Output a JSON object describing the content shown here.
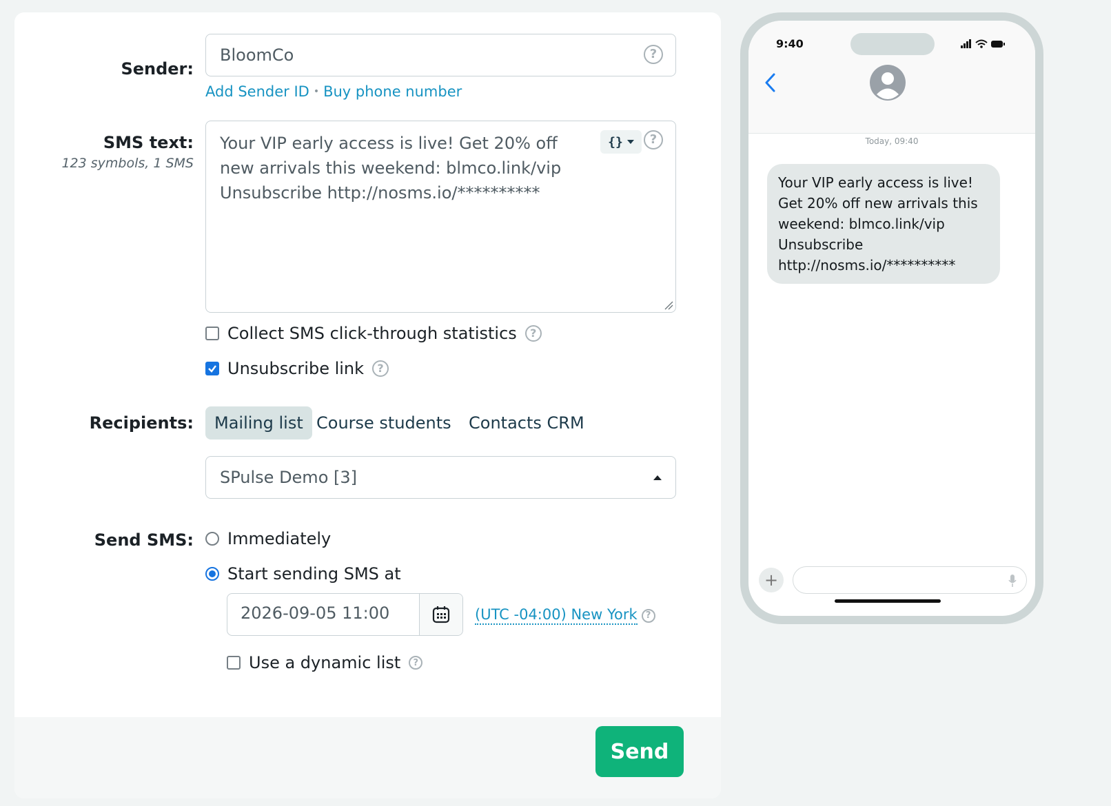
{
  "sender": {
    "label": "Sender:",
    "value": "BloomCo",
    "add_sender_id": "Add Sender ID",
    "separator": "•",
    "buy_phone_number": "Buy phone number"
  },
  "sms_text": {
    "label": "SMS text:",
    "stats": "123 symbols, 1 SMS",
    "value": "Your VIP early access is live! Get 20% off new arrivals this weekend: blmco.link/vip\nUnsubscribe http://nosms.io/**********",
    "variables_button": "{}"
  },
  "options": {
    "collect_stats_label": "Collect SMS click-through statistics",
    "collect_stats_checked": false,
    "unsubscribe_label": "Unsubscribe link",
    "unsubscribe_checked": true
  },
  "recipients": {
    "label": "Recipients:",
    "tabs": [
      {
        "label": "Mailing list",
        "active": true
      },
      {
        "label": "Course students",
        "active": false
      },
      {
        "label": "Contacts CRM",
        "active": false
      }
    ],
    "selected_list": "SPulse Demo [3]"
  },
  "send_sms": {
    "label": "Send SMS:",
    "immediately_label": "Immediately",
    "scheduled_label": "Start sending SMS at",
    "selected": "scheduled",
    "datetime": "2026-09-05 11:00",
    "timezone": "(UTC -04:00) New York",
    "dynamic_list_label": "Use a dynamic list",
    "dynamic_list_checked": false
  },
  "send_button": "Send",
  "help_glyph": "?",
  "phone": {
    "time": "9:40",
    "timestamp": "Today, 09:40",
    "message": "Your VIP early access is live! Get 20% off new arrivals this weekend: blmco.link/vip\nUnsubscribe\nhttp://nosms.io/**********",
    "plus": "+"
  },
  "colors": {
    "accent_link": "#1793c2",
    "send_button": "#0fb37a",
    "checkbox": "#1674e0",
    "active_tab": "#d8e3e3"
  }
}
